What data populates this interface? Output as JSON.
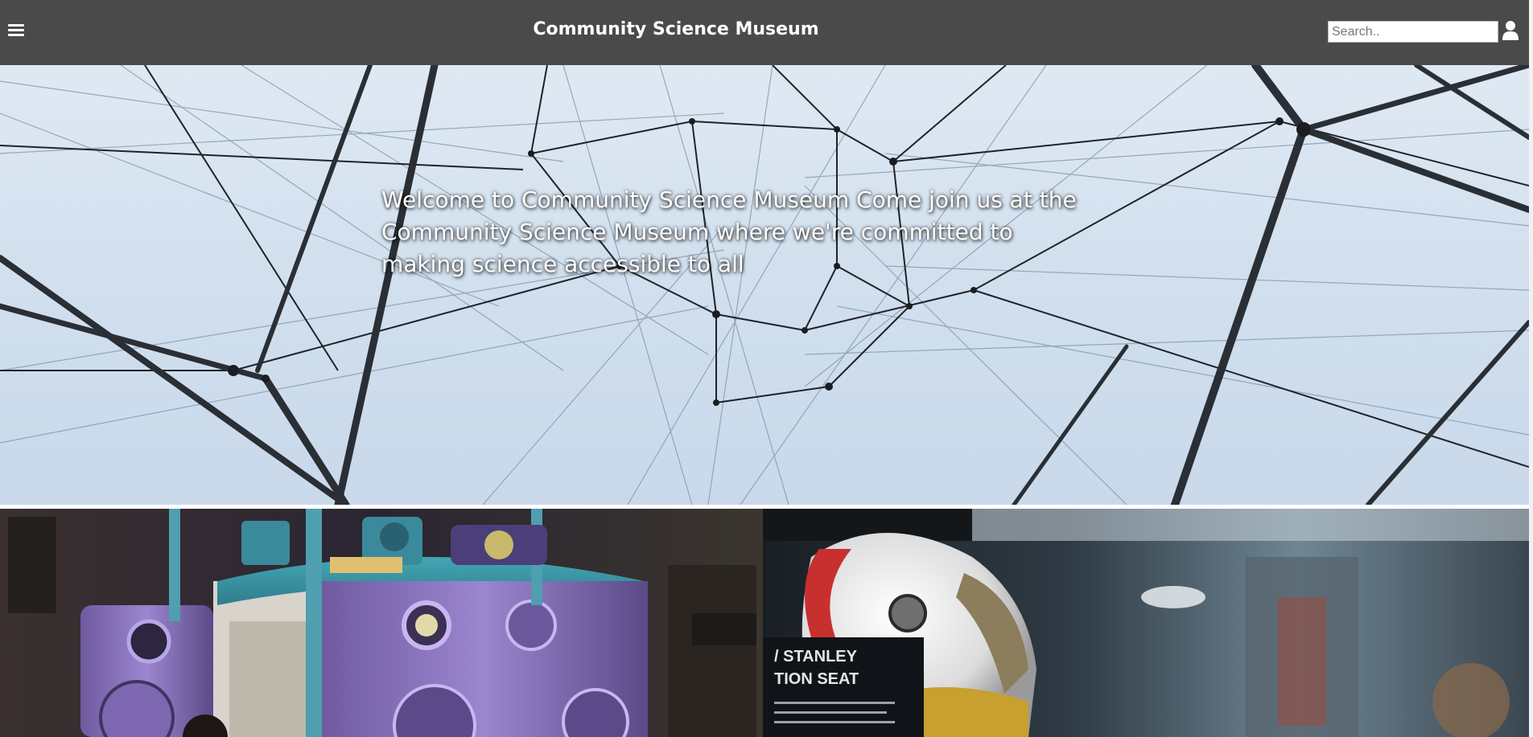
{
  "header": {
    "title": "Community Science Museum",
    "menu_icon": "hamburger-menu-icon",
    "search_placeholder": "Search..",
    "user_icon": "user-icon",
    "background_color": "#4a4a4a"
  },
  "hero": {
    "welcome_text": "Welcome to Community Science Museum Come join us at the Community Science Museum where we're committed to making science accessible to all",
    "image": "string-network-sculpture"
  },
  "tiles": [
    {
      "image": "vacuum-chamber-machinery"
    },
    {
      "image": "astronaut-helmet-exhibit",
      "sign_text": [
        "/ STANLEY",
        "TION SEAT"
      ]
    }
  ]
}
